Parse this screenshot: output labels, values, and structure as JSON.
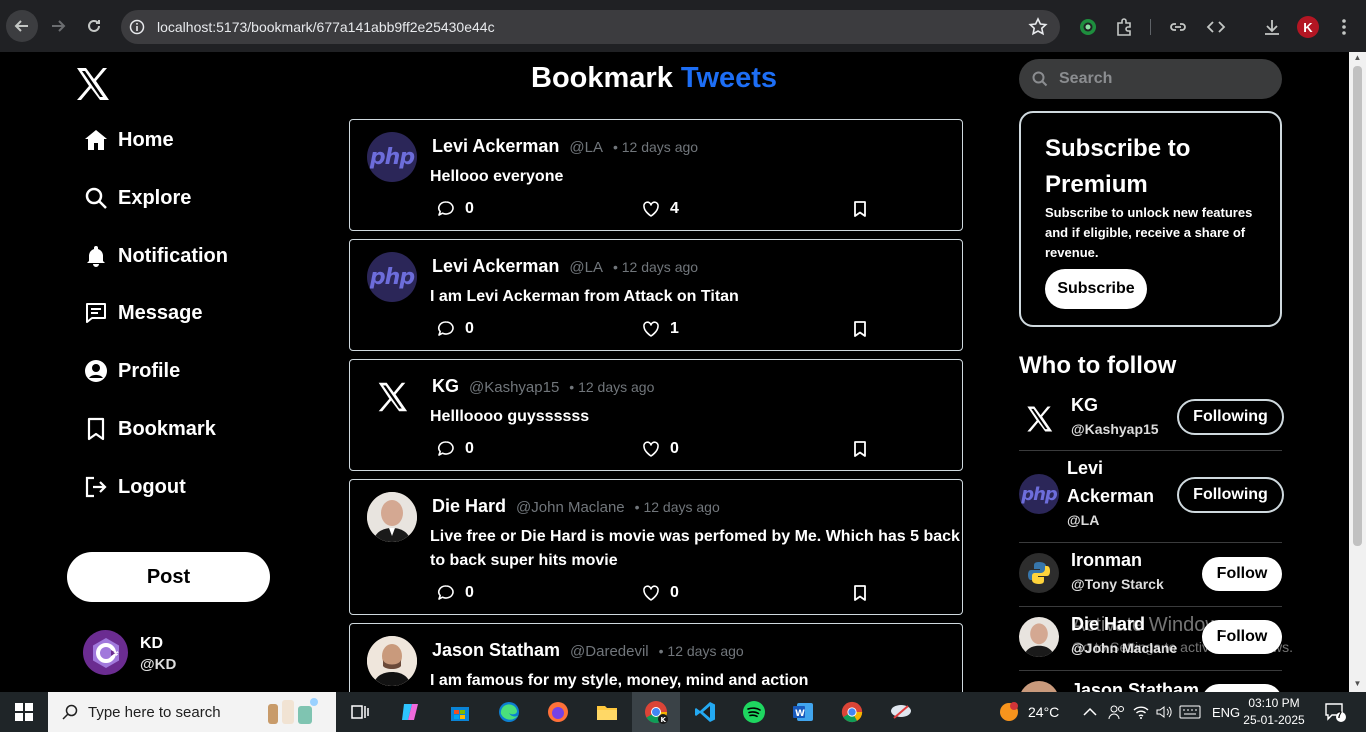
{
  "browser": {
    "url": "localhost:5173/bookmark/677a141abb9ff2e25430e44c",
    "profile_initial": "K"
  },
  "sidebar": {
    "items": [
      {
        "label": "Home",
        "icon": "home-icon"
      },
      {
        "label": "Explore",
        "icon": "search-icon"
      },
      {
        "label": "Notification",
        "icon": "bell-icon"
      },
      {
        "label": "Message",
        "icon": "message-icon"
      },
      {
        "label": "Profile",
        "icon": "user-icon"
      },
      {
        "label": "Bookmark",
        "icon": "bookmark-icon"
      },
      {
        "label": "Logout",
        "icon": "logout-icon"
      }
    ],
    "post_label": "Post",
    "user": {
      "name": "KD",
      "handle": "@KD"
    }
  },
  "main": {
    "title_part1": "Bookmark",
    "title_part2": "Tweets",
    "tweets": [
      {
        "name": "Levi Ackerman",
        "handle": "@LA",
        "time": "• 12 days ago",
        "text": "Hellooo everyone",
        "comments": "0",
        "likes": "4",
        "avatar": "php-logo"
      },
      {
        "name": "Levi Ackerman",
        "handle": "@LA",
        "time": "• 12 days ago",
        "text": "I am Levi Ackerman from Attack on Titan",
        "comments": "0",
        "likes": "1",
        "avatar": "php-logo"
      },
      {
        "name": "KG",
        "handle": "@Kashyap15",
        "time": "• 12 days ago",
        "text": "Hellloooo guyssssss",
        "comments": "0",
        "likes": "0",
        "avatar": "x-logo"
      },
      {
        "name": "Die Hard",
        "handle": "@John Maclane",
        "time": "• 12 days ago",
        "text": "Live free or Die Hard is movie was perfomed by Me. Which has 5 back to back super hits movie",
        "comments": "0",
        "likes": "0",
        "avatar": "face-photo"
      },
      {
        "name": "Jason Statham",
        "handle": "@Daredevil",
        "time": "• 12 days ago",
        "text": "I am famous for my style, money, mind and action",
        "comments": "",
        "likes": "",
        "avatar": "face-photo"
      }
    ]
  },
  "right": {
    "search_placeholder": "Search",
    "premium": {
      "title": "Subscribe to Premium",
      "text": "Subscribe to unlock new features and if eligible, receive a share of revenue.",
      "button": "Subscribe"
    },
    "who_to_follow_title": "Who to follow",
    "follow": [
      {
        "name": "KG",
        "handle": "@Kashyap15",
        "button": "Following"
      },
      {
        "name": "Levi Ackerman",
        "handle": "@LA",
        "button": "Following"
      },
      {
        "name": "Ironman",
        "handle": "@Tony Starck",
        "button": "Follow"
      },
      {
        "name": "Die Hard",
        "handle": "@John Maclane",
        "button": "Follow"
      },
      {
        "name": "Jason Statham",
        "handle": "",
        "button": ""
      }
    ],
    "watermark_line1": "Activate Windows",
    "watermark_line2": "Go to Settings to activate Windows."
  },
  "taskbar": {
    "search_placeholder": "Type here to search",
    "weather": "24°C",
    "language": "ENG",
    "time": "03:10 PM",
    "date": "25-01-2025",
    "notification_count": "7"
  },
  "colors": {
    "accent": "#1d6ef5",
    "background": "#000000",
    "border": "#cfd9de"
  }
}
